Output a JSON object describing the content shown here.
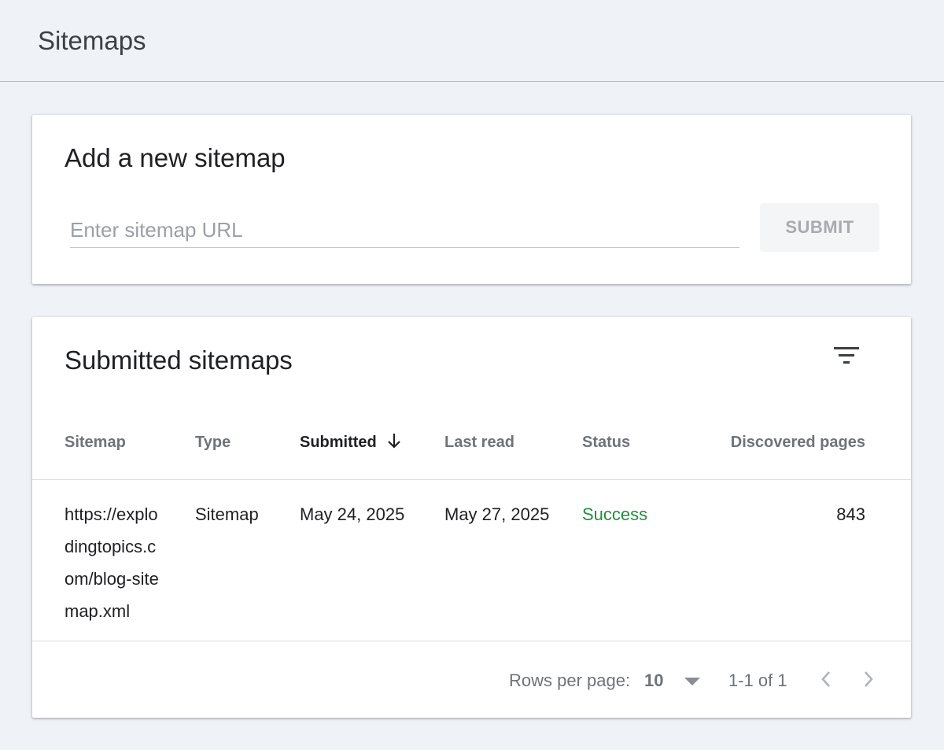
{
  "page": {
    "title": "Sitemaps"
  },
  "add_card": {
    "title": "Add a new sitemap",
    "input_placeholder": "Enter sitemap URL",
    "input_value": "",
    "submit_label": "SUBMIT"
  },
  "submitted_card": {
    "title": "Submitted sitemaps",
    "filter_icon": "filter-icon",
    "columns": [
      "Sitemap",
      "Type",
      "Submitted",
      "Last read",
      "Status",
      "Discovered pages"
    ],
    "sort_column": "Submitted",
    "sort_direction": "descending",
    "rows": [
      {
        "sitemap": "https://explodingtopics.com/blog-sitemap.xml",
        "type": "Sitemap",
        "submitted": "May 24, 2025",
        "last_read": "May 27, 2025",
        "status": "Success",
        "discovered_pages": "843"
      }
    ],
    "pagination": {
      "rows_per_page_label": "Rows per page:",
      "rows_per_page_value": "10",
      "range": "1-1 of 1"
    }
  },
  "colors": {
    "background": "#eff2f7",
    "card": "#ffffff",
    "success": "#1e8e3e",
    "muted_text": "#6f7378",
    "disabled_button_bg": "#f4f5f6"
  }
}
